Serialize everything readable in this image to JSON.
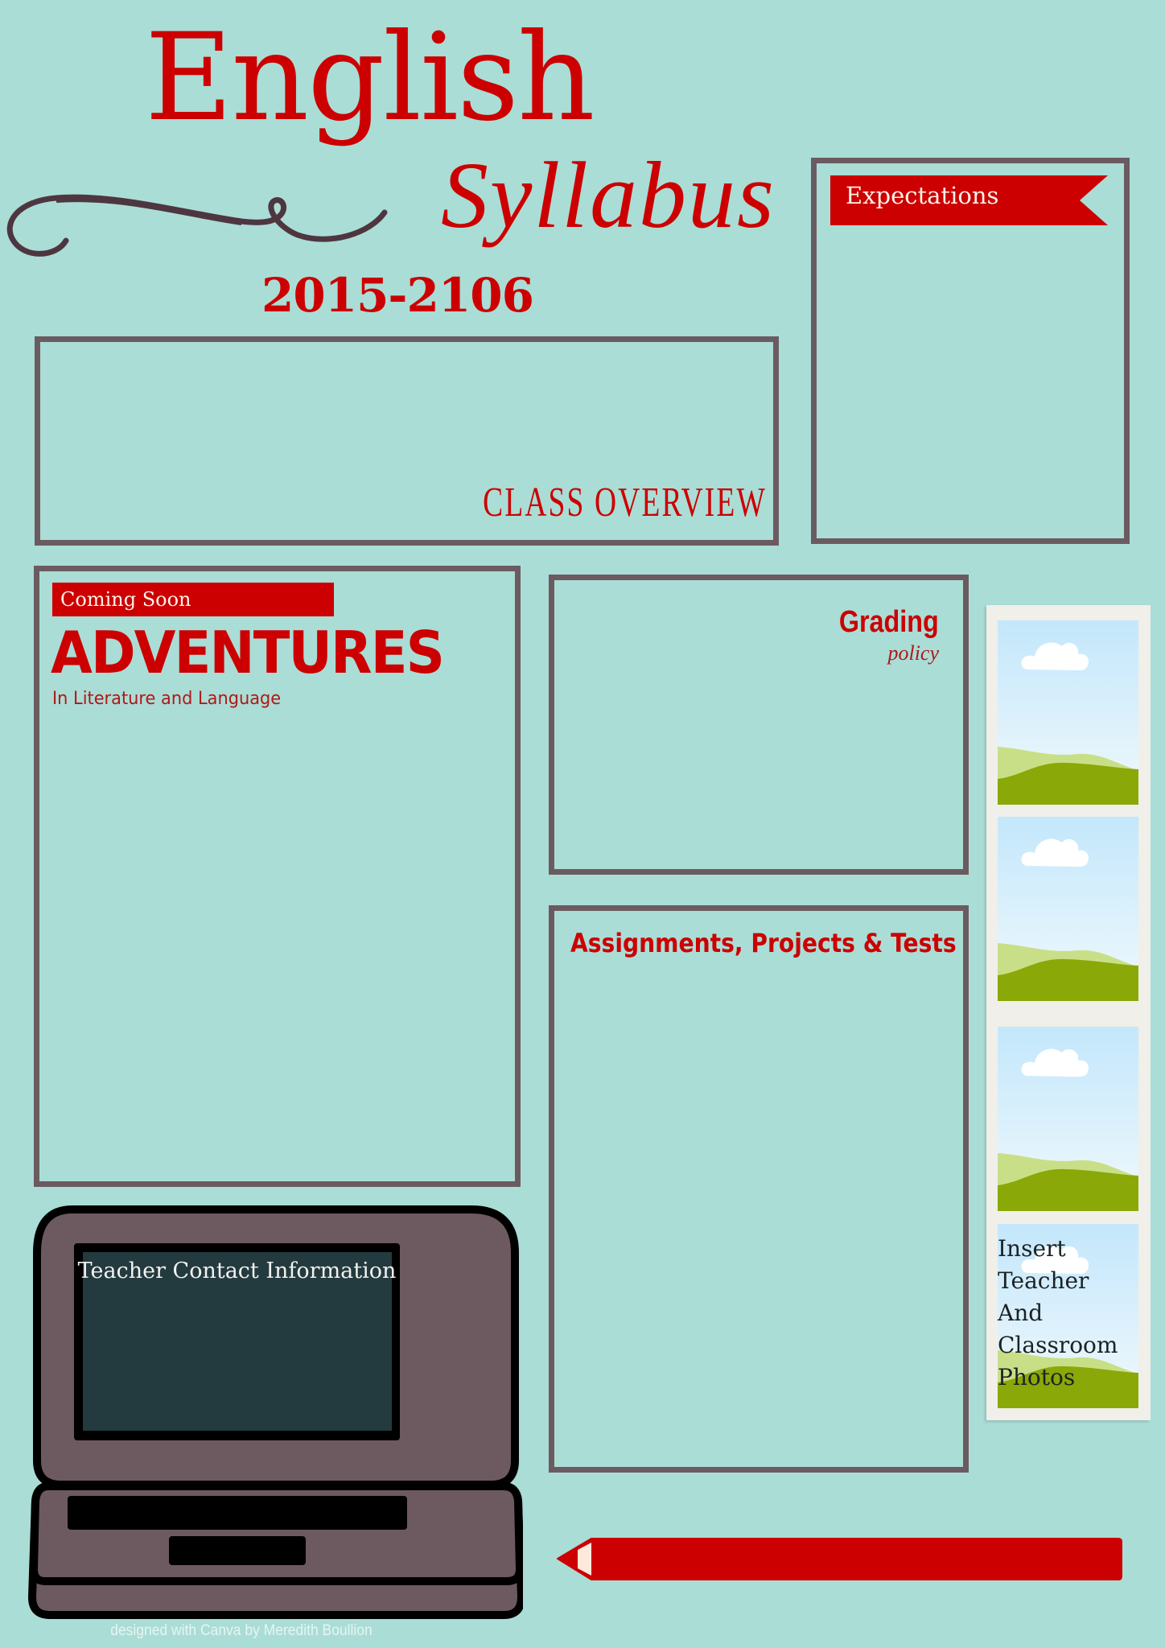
{
  "header": {
    "title": "English",
    "subtitle": "Syllabus",
    "years": "2015-2106"
  },
  "sections": {
    "class_overview": {
      "label": "CLASS OVERVIEW"
    },
    "expectations": {
      "label": "Expectations"
    },
    "adventures": {
      "badge": "Coming Soon",
      "title": "ADVENTURES",
      "subtitle": "In Literature and Language"
    },
    "grading": {
      "title": "Grading",
      "subtitle": "policy"
    },
    "assignments": {
      "title": "Assignments, Projects & Tests"
    },
    "teacher_contact": {
      "label": "Teacher Contact Information"
    },
    "photos": {
      "caption_lines": [
        "Insert",
        "Teacher",
        "And",
        "Classroom",
        "Photos"
      ],
      "placeholder_count": 4,
      "icon": "landscape-placeholder-icon"
    }
  },
  "decorations": {
    "swirl": "flourish-swirl",
    "laptop": "laptop-icon",
    "pencil": "pencil-icon"
  },
  "footer": {
    "credit": "designed with Canva by Meredith Boullion"
  },
  "colors": {
    "background": "#aaddd6",
    "accent_red": "#cc0000",
    "border_gray": "#6b5b61",
    "laptop_body": "#6d5a60",
    "laptop_screen": "#233a3f"
  }
}
